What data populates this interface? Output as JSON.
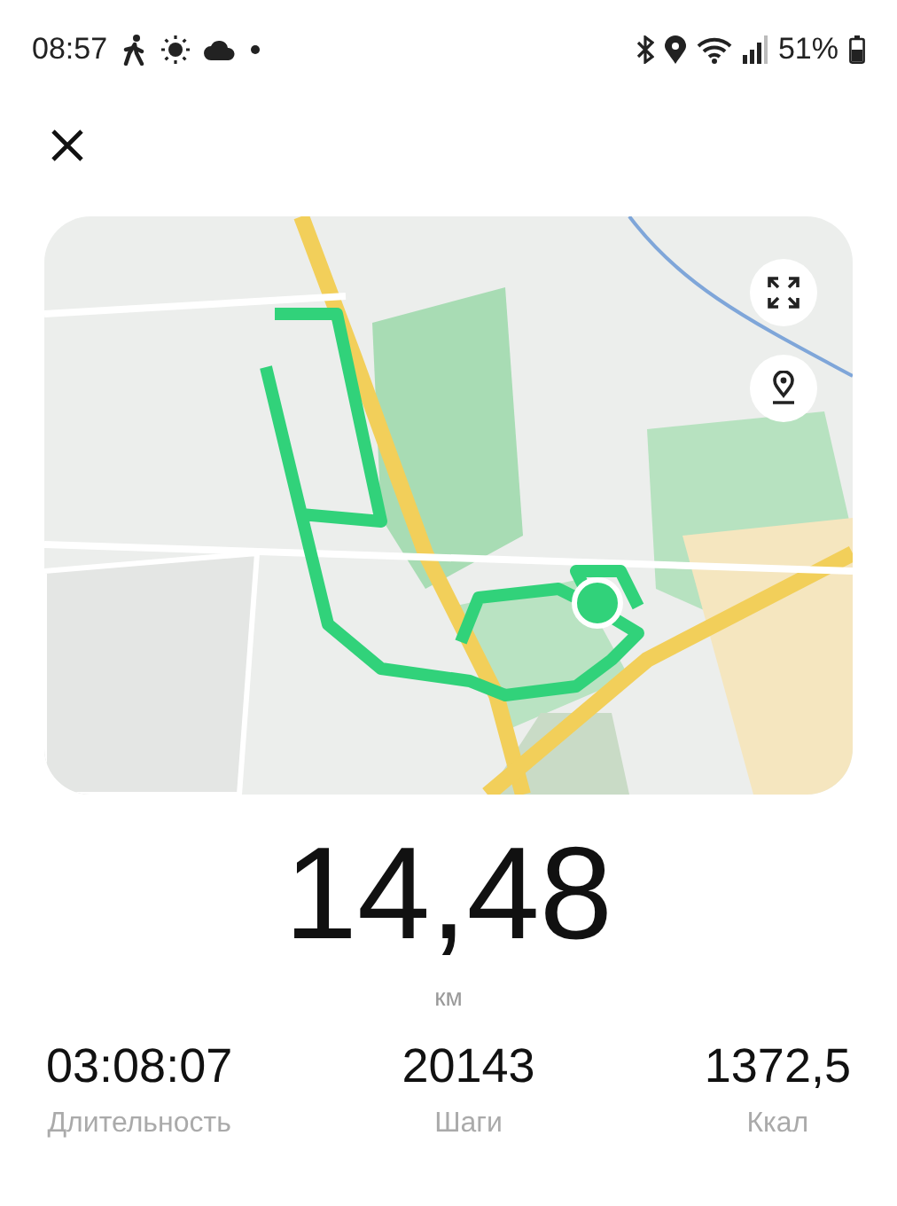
{
  "status_bar": {
    "time": "08:57",
    "battery": "51%"
  },
  "distance": {
    "value": "14,48",
    "unit": "км"
  },
  "stats": [
    {
      "value": "03:08:07",
      "label": "Длительность"
    },
    {
      "value": "20143",
      "label": "Шаги"
    },
    {
      "value": "1372,5",
      "label": "Ккал"
    }
  ]
}
